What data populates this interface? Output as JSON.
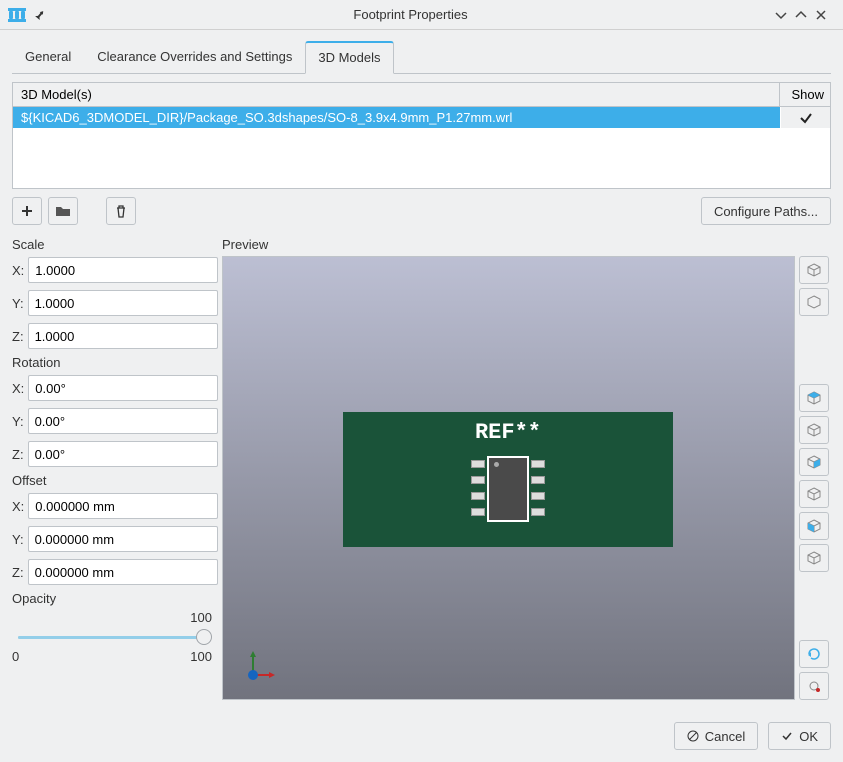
{
  "window": {
    "title": "Footprint Properties"
  },
  "tabs": {
    "general": "General",
    "clearance": "Clearance Overrides and Settings",
    "models3d": "3D Models"
  },
  "model_table": {
    "header_path": "3D Model(s)",
    "header_show": "Show",
    "rows": [
      {
        "path": "${KICAD6_3DMODEL_DIR}/Package_SO.3dshapes/SO-8_3.9x4.9mm_P1.27mm.wrl",
        "show": true
      }
    ]
  },
  "buttons": {
    "configure_paths": "Configure Paths...",
    "cancel": "Cancel",
    "ok": "OK"
  },
  "groups": {
    "scale": {
      "label": "Scale",
      "x": "1.0000",
      "y": "1.0000",
      "z": "1.0000"
    },
    "rotation": {
      "label": "Rotation",
      "x": "0.00°",
      "y": "0.00°",
      "z": "0.00°"
    },
    "offset": {
      "label": "Offset",
      "x": "0.000000 mm",
      "y": "0.000000 mm",
      "z": "0.000000 mm"
    },
    "opacity": {
      "label": "Opacity",
      "min": "0",
      "max": "100",
      "value_top": "100"
    }
  },
  "axis_labels": {
    "x": "X:",
    "y": "Y:",
    "z": "Z:"
  },
  "preview": {
    "label": "Preview",
    "ref_text": "REF**"
  }
}
